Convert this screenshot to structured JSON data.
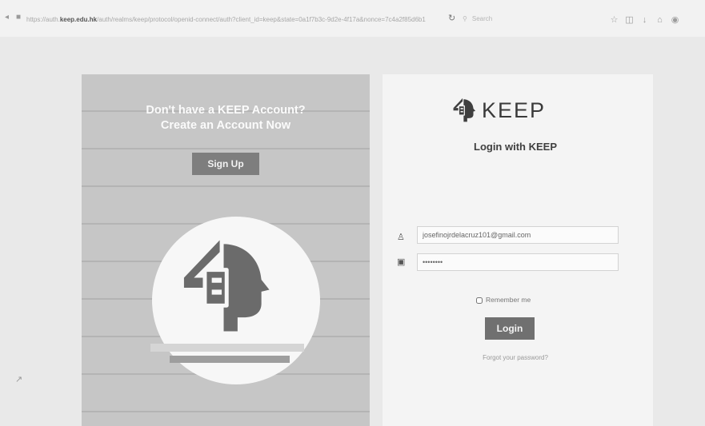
{
  "browser": {
    "url_prefix": "https://auth.",
    "url_domain": "keep.edu.hk",
    "url_path": "/auth/realms/keep/protocol/openid-connect/auth?client_id=keep&state=0a1f7b3c-9d2e-4f17a&nonce=7c4a2f85d6b1",
    "search_placeholder": "Search",
    "icons": [
      "back-icon",
      "lock-icon",
      "reload-icon",
      "search-icon",
      "star-icon",
      "library-icon",
      "download-icon",
      "home-icon",
      "shield-icon"
    ]
  },
  "promo": {
    "line1": "Don't have a KEEP Account?",
    "line2": "Create an Account Now",
    "signup_label": "Sign Up"
  },
  "login": {
    "brand_name": "KEEP",
    "title": "Login with KEEP",
    "email_value": "josefinojrdelacruz101@gmail.com",
    "password_value": "••••••••",
    "remember_label": "Remember me",
    "login_label": "Login",
    "forgot_label": "Forgot your password?"
  },
  "colors": {
    "panel_gray": "#c6c6c6",
    "button_gray": "#707070",
    "background": "#e9e9e9"
  }
}
